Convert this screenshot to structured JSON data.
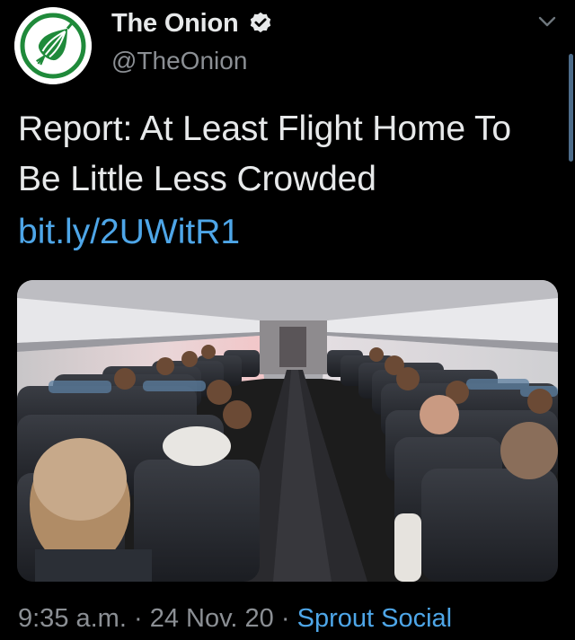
{
  "account": {
    "display_name": "The Onion",
    "handle": "@TheOnion",
    "avatar_icon": "onion-logo-icon",
    "verified_icon": "verified-badge-icon"
  },
  "tweet": {
    "text": "Report: At Least Flight Home To Be Little Less Crowded",
    "link": "bit.ly/2UWitR1",
    "media_description_icon": "airplane-cabin-photo",
    "time": "9:35 a.m.",
    "date": "24 Nov. 20",
    "separator": "·",
    "source": "Sprout Social"
  },
  "colors": {
    "background": "#000000",
    "text": "#e7e9ea",
    "secondary": "#8b8f94",
    "link": "#4ea6e8",
    "brand_green": "#1f8a3a"
  }
}
